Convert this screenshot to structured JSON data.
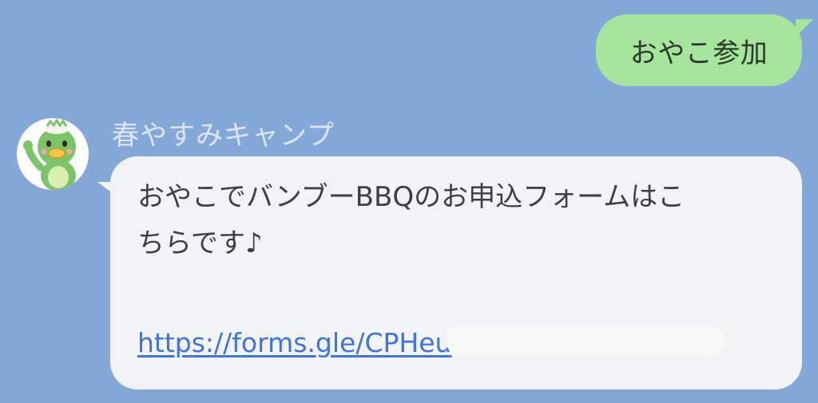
{
  "colors": {
    "background": "#84a9d8",
    "outgoing_bubble": "#a5e59c",
    "incoming_bubble": "#f2f3f5",
    "link": "#3f73e2",
    "sender_name": "#dce6f3"
  },
  "outgoing": {
    "text": "おやこ参加"
  },
  "incoming": {
    "sender_name": "春やすみキャンプ",
    "avatar_icon": "kappa-mascot-icon",
    "text": "おやこでバンブーBBQのお申込フォームはこ\nちらです♪",
    "link_text": "https://forms.gle/CPHeu"
  }
}
